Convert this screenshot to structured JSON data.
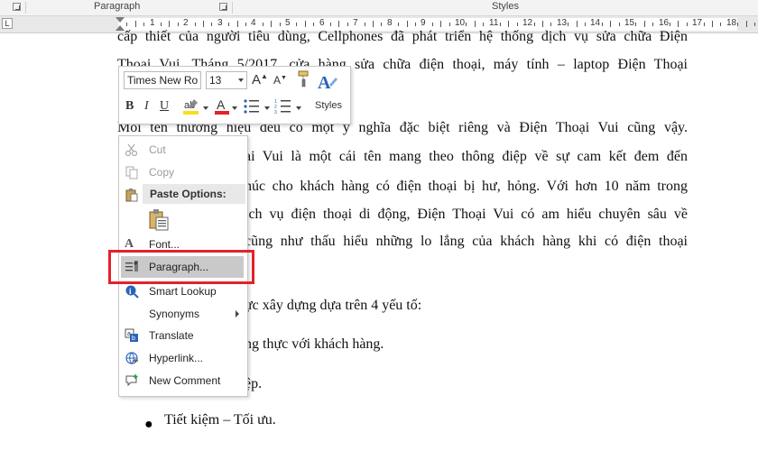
{
  "ribbon": {
    "paragraph_group_label": "Paragraph",
    "styles_group_label": "Styles"
  },
  "ruler": {
    "numbers": [
      "1",
      "2",
      "3",
      "4",
      "5",
      "6",
      "7",
      "8",
      "9",
      "10",
      "11",
      "12",
      "13",
      "14",
      "15",
      "16",
      "17",
      "18"
    ]
  },
  "document": {
    "lines": [
      "cấp thiết của người tiêu dùng, Cellphones đã phát triển hệ thống dịch vụ sửa chữa Điện",
      "Thoại Vui. Tháng 5/2017, cửa hàng sửa chữa điện thoại, máy tính – laptop Điện Thoại",
      "Mỗi tên thương hiệu đều có một ý nghĩa đặc biệt riêng và Điện Thoại Vui cũng vậy.",
      "ại Vui là một cái tên mang theo thông điệp về sự cam kết đem đến",
      "húc cho khách hàng có điện thoại bị hư, hỏng. Với hơn 10 năm trong",
      "ịch vụ điện thoại di động, Điện Thoại Vui có am hiểu chuyên sâu về",
      "cũng như thấu hiểu những lo lắng của khách hàng khi có điện thoại",
      "ực xây dựng dựa trên 4 yếu tố:",
      "ng thực với khách hàng.",
      "ệp."
    ],
    "bullet_item": "Tiết kiệm – Tối ưu."
  },
  "mini_toolbar": {
    "font_name": "Times New Ro",
    "font_size": "13",
    "styles_label": "Styles",
    "highlight_color": "#f5e11b",
    "font_color": "#e3222a"
  },
  "context_menu": {
    "items": {
      "cut": "Cut",
      "copy": "Copy",
      "paste_options": "Paste Options:",
      "font": "Font...",
      "paragraph": "Paragraph...",
      "smart_lookup": "Smart Lookup",
      "synonyms": "Synonyms",
      "translate": "Translate",
      "hyperlink": "Hyperlink...",
      "new_comment": "New Comment"
    }
  },
  "colors": {
    "highlight_box": "#e3222a",
    "menu_hover": "#c9c9c9"
  }
}
